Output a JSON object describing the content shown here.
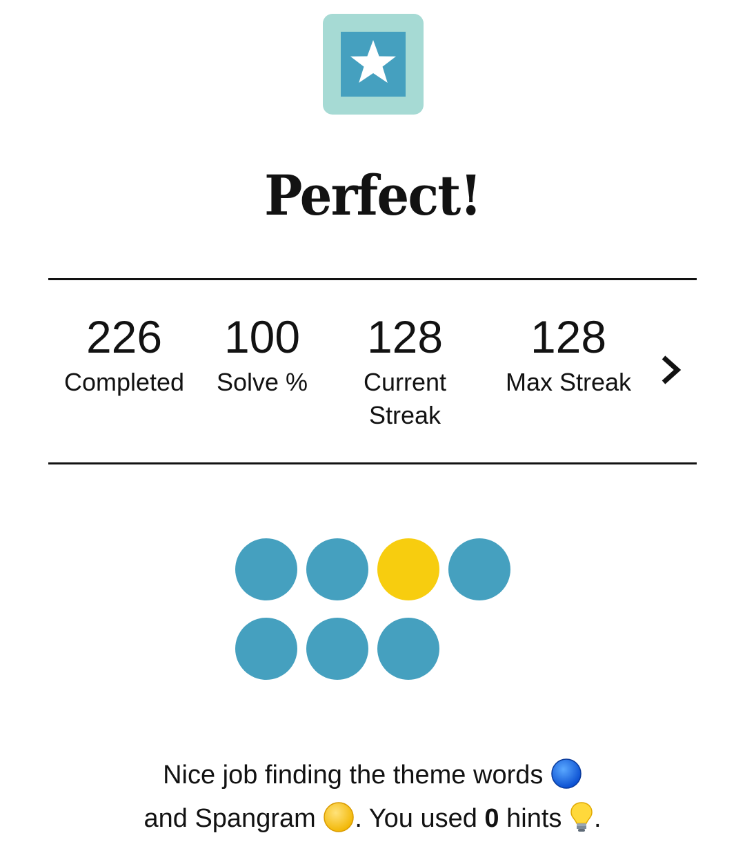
{
  "badge": {
    "icon": "star-icon"
  },
  "headline": "Perfect!",
  "stats": [
    {
      "value": "226",
      "label": "Completed"
    },
    {
      "value": "100",
      "label": "Solve %"
    },
    {
      "value": "128",
      "label": "Current Streak"
    },
    {
      "value": "128",
      "label": "Max Streak"
    }
  ],
  "more_stats_icon": "chevron-right-icon",
  "results": {
    "rows": [
      [
        "theme",
        "theme",
        "spangram",
        "theme"
      ],
      [
        "theme",
        "theme",
        "theme"
      ]
    ],
    "colors": {
      "theme": "#45a0bf",
      "spangram": "#f7cd0f"
    }
  },
  "summary": {
    "line1": "Nice job finding the theme words",
    "line2_start": "and Spangram",
    "line2_mid": ". You used ",
    "hints_count": "0",
    "hints_word": " hints",
    "line2_end": "."
  }
}
